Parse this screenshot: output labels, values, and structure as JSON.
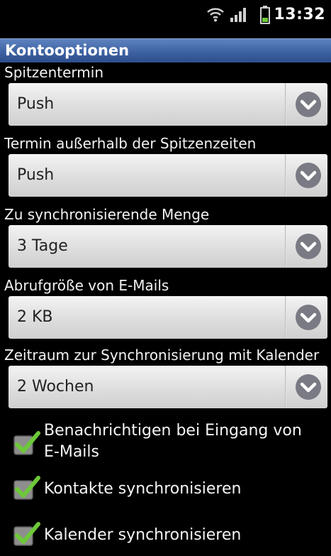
{
  "status_bar": {
    "time": "13:32",
    "icons": [
      "wifi-icon",
      "signal-icon",
      "battery-icon"
    ]
  },
  "header": {
    "title": "Kontooptionen"
  },
  "settings": [
    {
      "label": "Spitzentermin",
      "value": "Push"
    },
    {
      "label": "Termin außerhalb der Spitzenzeiten",
      "value": "Push"
    },
    {
      "label": "Zu synchronisierende Menge",
      "value": "3 Tage"
    },
    {
      "label": "Abrufgröße von E-Mails",
      "value": "2 KB"
    },
    {
      "label": "Zeitraum zur Synchronisierung mit Kalender",
      "value": "2 Wochen"
    }
  ],
  "checkboxes": [
    {
      "label": "Benachrichtigen bei Eingang von E-Mails",
      "checked": true
    },
    {
      "label": "Kontakte synchronisieren",
      "checked": true
    },
    {
      "label": "Kalender synchronisieren",
      "checked": true
    }
  ],
  "colors": {
    "title_bar": "#3e62a3",
    "check_green": "#6dc83a",
    "dropdown_bg": "#dedede",
    "arrow_circle": "#7a7a84"
  }
}
